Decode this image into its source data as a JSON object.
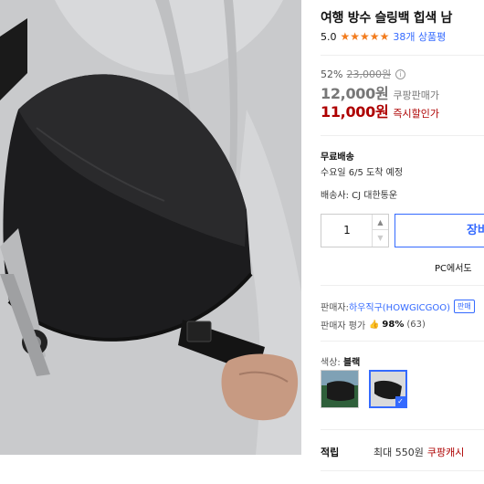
{
  "product": {
    "title": "여행 방수 슬링백 힙색 남",
    "rating_score": "5.0",
    "star_count": 5,
    "review_count": "38개 상품평"
  },
  "price": {
    "discount_rate": "52%",
    "original": "23,000원",
    "sale_price": "12,000원",
    "sale_label": "쿠팡판매가",
    "instant_price": "11,000원",
    "instant_label": "즉시할인가"
  },
  "shipping": {
    "title": "무료배송",
    "delivery_date": "수요일 6/5 도착 예정",
    "carrier": "배송사: CJ 대한통운"
  },
  "purchase": {
    "quantity": "1",
    "cart_label": "장바",
    "pc_only": "PC에서도"
  },
  "seller": {
    "label": "판매자: ",
    "name": "하우직구(HOWGICGOO)",
    "badge": "판매",
    "eval_label": "판매자 평가",
    "eval_percent": "98%",
    "eval_count": "(63)"
  },
  "options": {
    "color_label": "색상: ",
    "color_value": "블랙"
  },
  "points": {
    "label": "적립",
    "max_text": "최대 550원",
    "brand": "쿠팡캐시"
  },
  "colors": {
    "accent": "#346aff",
    "price_red": "#ae0000",
    "star": "#f27c1e"
  }
}
